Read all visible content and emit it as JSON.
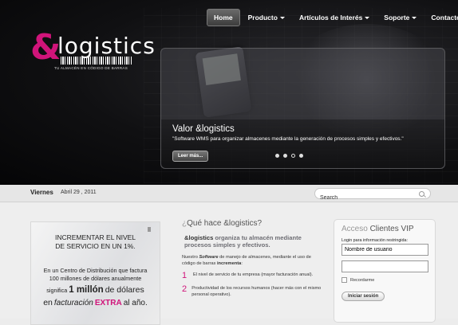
{
  "nav": {
    "items": [
      {
        "label": "Home",
        "active": true,
        "dropdown": false
      },
      {
        "label": "Producto",
        "active": false,
        "dropdown": true
      },
      {
        "label": "Artículos de Interés",
        "active": false,
        "dropdown": true
      },
      {
        "label": "Soporte",
        "active": false,
        "dropdown": true
      },
      {
        "label": "Contacto",
        "active": false,
        "dropdown": false
      }
    ]
  },
  "logo": {
    "amp": "&",
    "word": "logistics",
    "tagline": "TU ALMACÉN EN CÓDIGO DE BARRAS"
  },
  "slide": {
    "title": "Valor &logistics",
    "text": "\"Software WMS para organizar almacenes  mediante la generación de procesos simples y efectivos.\"",
    "more_label": "Leer más...",
    "dots": 4,
    "active_dot": 2
  },
  "datebar": {
    "day": "Viernes",
    "date": "Abril 29 , 2011",
    "search_placeholder": "Search"
  },
  "promo": {
    "heading_line1": "INCREMENTAR EL NIVEL",
    "heading_line2": "DE SERVICIO EN UN 1%.",
    "line1": "En un Centro de Distribución que factura",
    "line2": "100 millones de dólares anualmente",
    "line3_pre": "significa",
    "line3_big": "1 millón",
    "line3_post": "de dólares",
    "line4_pre": "en",
    "line4_em": "facturación",
    "line4_extra": "EXTRA",
    "line4_post": "al año."
  },
  "intro": {
    "q_mark": "¿",
    "question": "Qué hace &logistics?",
    "lead_brand": "&logistics",
    "lead_rest": " organiza tu almacén mediante",
    "lead_bold": "procesos simples y efectivos.",
    "body_pre": "Nuestro ",
    "body_software": "Software",
    "body_mid": " de manejo de almacenes, mediante el uso de  código de barras ",
    "body_bold": "incrementa",
    "body_end": ":",
    "list": [
      {
        "num": "1",
        "text": "El nivel de servicio de tu empresa (mayor facturación anual)."
      },
      {
        "num": "2",
        "text": "Productividad de los recursos humanos (hacer más con el mismo personal operativo)."
      }
    ]
  },
  "login": {
    "title_a": "Acceso ",
    "title_b": "Clientes VIP",
    "note": "Login para información restringida:",
    "username_value": "Nombre de usuario",
    "password_value": "",
    "remember_label": "Recordarme",
    "submit_label": "Iniciar sesión"
  },
  "colors": {
    "brand": "#d0147a",
    "nav_active": "#4a4a4a"
  }
}
